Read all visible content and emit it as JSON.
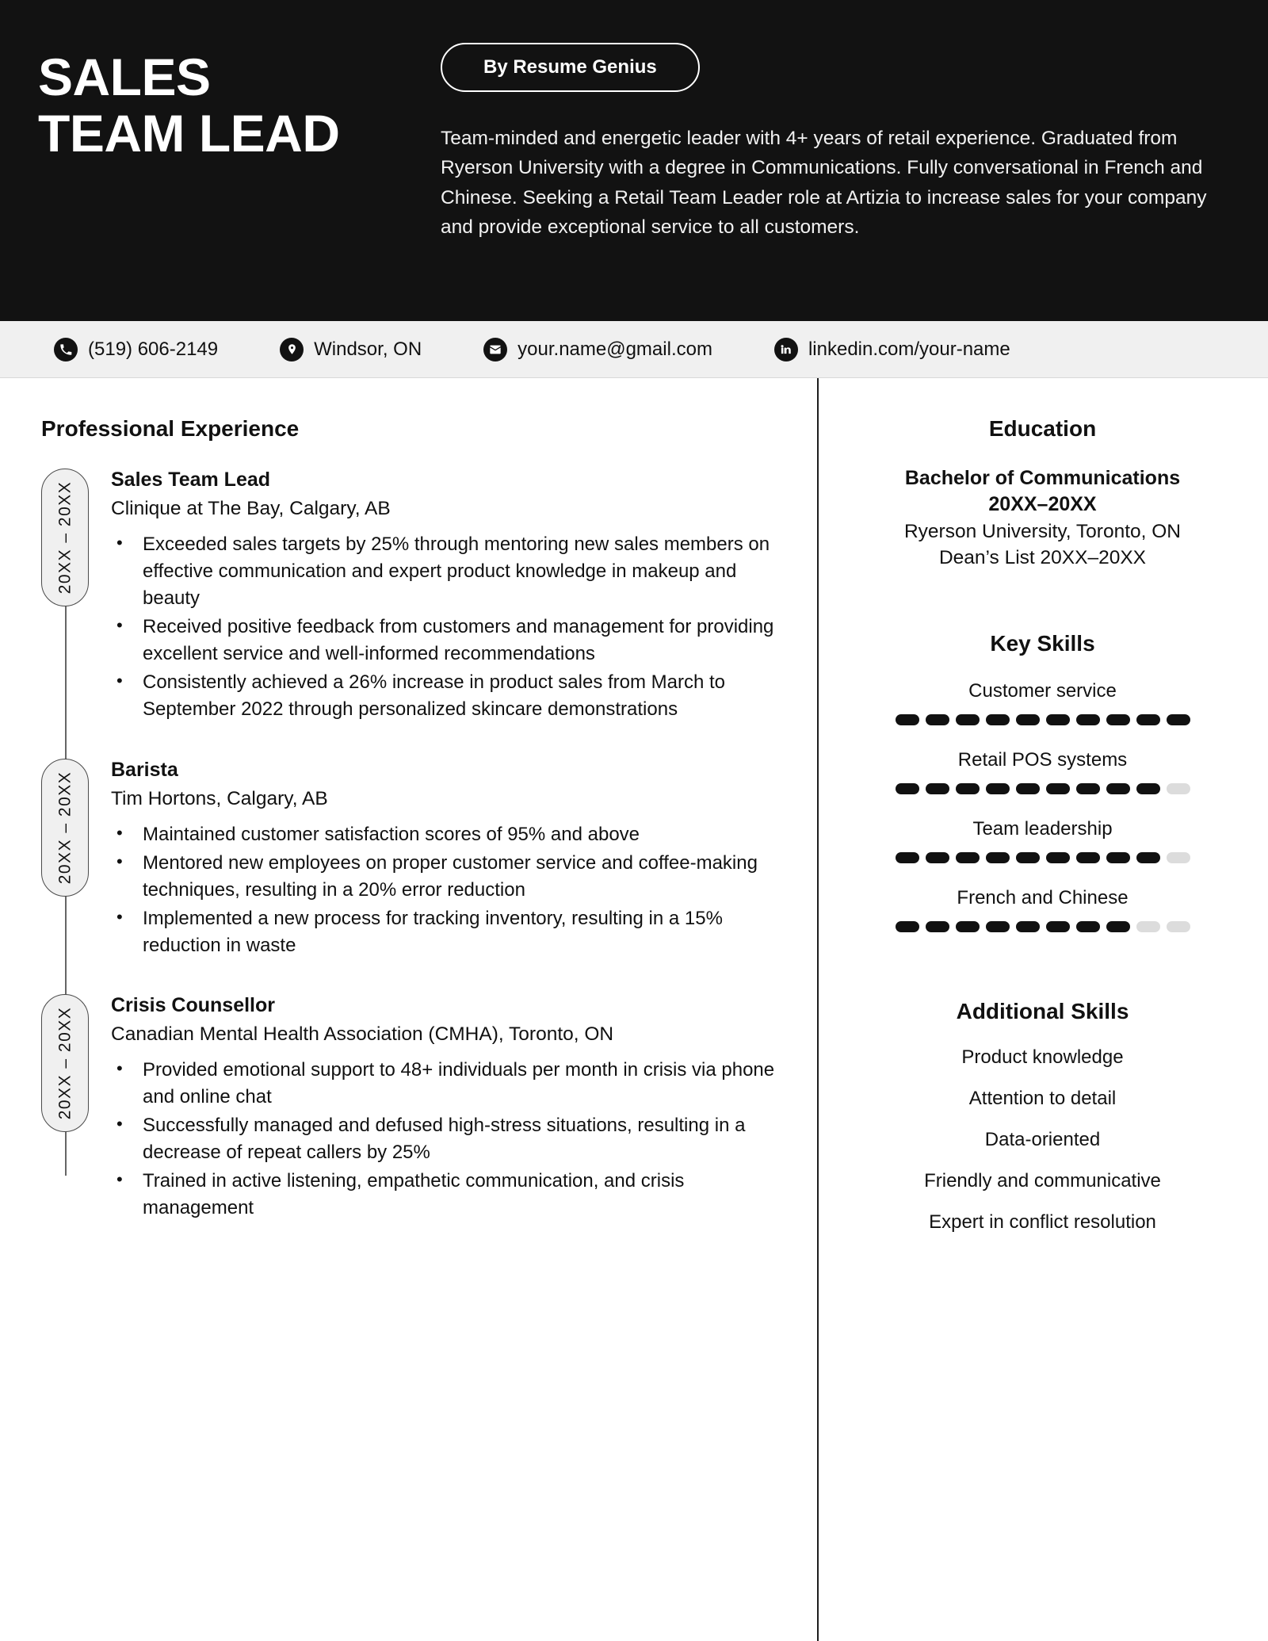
{
  "header": {
    "name_lines": [
      "SALES",
      "TEAM LEAD"
    ],
    "badge_label": "By Resume Genius",
    "summary": "Team-minded and energetic leader with 4+ years of retail experience. Graduated from Ryerson University with a degree in Communications. Fully conversational in French and Chinese. Seeking a Retail Team Leader role at Artizia to increase sales for your company and provide exceptional service to all customers."
  },
  "contact": {
    "items": [
      {
        "icon": "phone-icon",
        "text": "(519) 606-2149"
      },
      {
        "icon": "location-pin-icon",
        "text": "Windsor, ON"
      },
      {
        "icon": "envelope-icon",
        "text": "your.name@gmail.com"
      },
      {
        "icon": "linkedin-icon",
        "text": "linkedin.com/your-name"
      }
    ]
  },
  "experience": {
    "section_title": "Professional Experience",
    "jobs": [
      {
        "dates": "20XX – 20XX",
        "title": "Sales Team Lead",
        "org": "Clinique at The Bay, Calgary, AB",
        "bullets": [
          "Exceeded sales targets by 25% through mentoring new sales members on effective communication and expert product knowledge in makeup and beauty",
          "Received positive feedback from customers and management for providing excellent service and well-informed recommendations",
          "Consistently achieved a 26% increase in product sales from March to September 2022 through personalized skincare demonstrations"
        ]
      },
      {
        "dates": "20XX – 20XX",
        "title": "Barista",
        "org": "Tim Hortons, Calgary, AB",
        "bullets": [
          "Maintained customer satisfaction scores of 95% and above",
          "Mentored new employees on proper customer service and coffee-making techniques, resulting in a 20% error reduction",
          "Implemented a new process for tracking inventory, resulting in a 15% reduction in waste"
        ]
      },
      {
        "dates": "20XX – 20XX",
        "title": "Crisis Counsellor",
        "org": "Canadian Mental Health Association (CMHA), Toronto, ON",
        "bullets": [
          "Provided emotional support to 48+ individuals per month in crisis via phone and online chat",
          "Successfully managed and defused high-stress situations, resulting in a decrease of repeat callers by 25%",
          "Trained in active listening, empathetic communication, and crisis management"
        ]
      }
    ]
  },
  "education": {
    "section_title": "Education",
    "degree": "Bachelor of Communications",
    "degree_dates": "20XX–20XX",
    "school": "Ryerson University, Toronto, ON",
    "honors": "Dean’s List 20XX–20XX"
  },
  "key_skills": {
    "section_title": "Key Skills",
    "max_level": 10,
    "items": [
      {
        "label": "Customer service",
        "level": 10
      },
      {
        "label": "Retail POS systems",
        "level": 9
      },
      {
        "label": "Team leadership",
        "level": 9
      },
      {
        "label": "French and Chinese",
        "level": 8
      }
    ]
  },
  "additional_skills": {
    "section_title": "Additional Skills",
    "items": [
      "Product knowledge",
      "Attention to detail",
      "Data-oriented",
      "Friendly and communicative",
      "Expert in conflict resolution"
    ]
  },
  "colors": {
    "header_bg": "#121212",
    "contact_bg": "#f0f0f0",
    "accent": "#111111",
    "dash_on": "#111111",
    "dash_off": "#dcdcdc"
  }
}
